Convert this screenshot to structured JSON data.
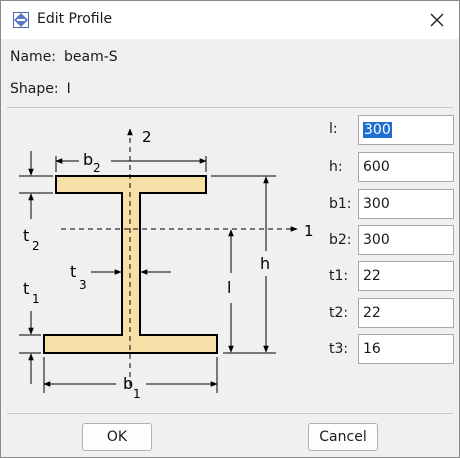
{
  "window": {
    "title": "Edit Profile"
  },
  "profile": {
    "name_label": "Name:",
    "name_value": "beam-S",
    "shape_label": "Shape:",
    "shape_value": "I"
  },
  "diagram": {
    "axis2": "2",
    "axis1": "1",
    "b2": "b",
    "b2_sub": "2",
    "t2": "t",
    "t2_sub": "2",
    "t3": "t",
    "t3_sub": "3",
    "t1": "t",
    "t1_sub": "1",
    "b1": "b",
    "b1_sub": "1",
    "h": "h",
    "l": "l"
  },
  "fields": [
    {
      "label": "l:",
      "value": "300",
      "selected": true
    },
    {
      "label": "h:",
      "value": "600"
    },
    {
      "label": "b1:",
      "value": "300"
    },
    {
      "label": "b2:",
      "value": "300"
    },
    {
      "label": "t1:",
      "value": "22"
    },
    {
      "label": "t2:",
      "value": "22"
    },
    {
      "label": "t3:",
      "value": "16"
    }
  ],
  "buttons": {
    "ok": "OK",
    "cancel": "Cancel"
  }
}
